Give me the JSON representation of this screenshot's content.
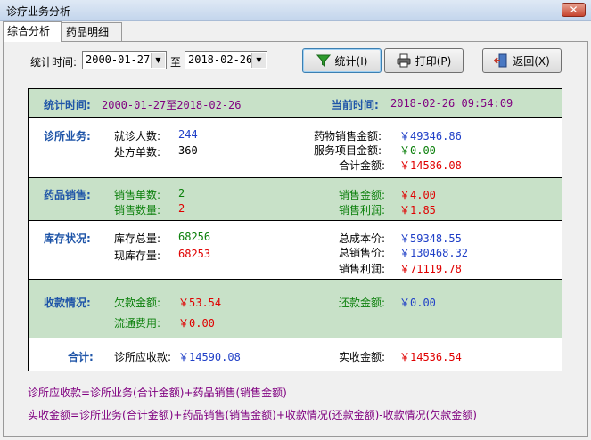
{
  "window": {
    "title": "诊疗业务分析",
    "close": "✕"
  },
  "tabs": [
    {
      "label": "综合分析"
    },
    {
      "label": "药品明细"
    }
  ],
  "toolbar": {
    "time_label": "统计时间:",
    "start_date": "2000-01-27",
    "to_label": "至",
    "end_date": "2018-02-26",
    "stat_button": "统计(I)",
    "print_button": "打印(P)",
    "back_button": "返回(X)"
  },
  "header": {
    "stat_time_label": "统计时间:",
    "stat_time_value": "2000-01-27至2018-02-26",
    "current_time_label": "当前时间:",
    "current_time_value": "2018-02-26 09:54:09"
  },
  "clinic": {
    "title": "诊所业务:",
    "visits_label": "就诊人数:",
    "visits_value": "244",
    "rx_label": "处方单数:",
    "rx_value": "360",
    "drug_sales_label": "药物销售金额:",
    "drug_sales_value": "￥49346.86",
    "service_label": "服务项目金额:",
    "service_value": "￥0.00",
    "total_label": "合计金额:",
    "total_value": "￥14586.08"
  },
  "drug_sales": {
    "title": "药品销售:",
    "orders_label": "销售单数:",
    "orders_value": "2",
    "qty_label": "销售数量:",
    "qty_value": "2",
    "amount_label": "销售金额:",
    "amount_value": "￥4.00",
    "profit_label": "销售利润:",
    "profit_value": "￥1.85"
  },
  "inventory": {
    "title": "库存状况:",
    "total_stock_label": "库存总量:",
    "total_stock_value": "68256",
    "current_stock_label": "现库存量:",
    "current_stock_value": "68253",
    "cost_label": "总成本价:",
    "cost_value": "￥59348.55",
    "sale_label": "总销售价:",
    "sale_value": "￥130468.32",
    "profit_label": "销售利润:",
    "profit_value": "￥71119.78"
  },
  "payment": {
    "title": "收款情况:",
    "owed_label": "欠款金额:",
    "owed_value": "￥53.54",
    "circ_label": "流通费用:",
    "circ_value": "￥0.00",
    "repaid_label": "还款金额:",
    "repaid_value": "￥0.00"
  },
  "total": {
    "title": "合计:",
    "receivable_label": "诊所应收款:",
    "receivable_value": "￥14590.08",
    "received_label": "实收金额:",
    "received_value": "￥14536.54"
  },
  "formulas": {
    "line1": "诊所应收款=诊所业务(合计金额)+药品销售(销售金额)",
    "line2": "实收金额=诊所业务(合计金额)+药品销售(销售金额)+收款情况(还款金额)-收款情况(欠款金额)"
  },
  "colors": {
    "band_green": "#c8e1c8",
    "label_blue": "#1f55a8",
    "value_red": "#e00000",
    "value_blue": "#1f3fc7",
    "formula_purple": "#800080"
  }
}
